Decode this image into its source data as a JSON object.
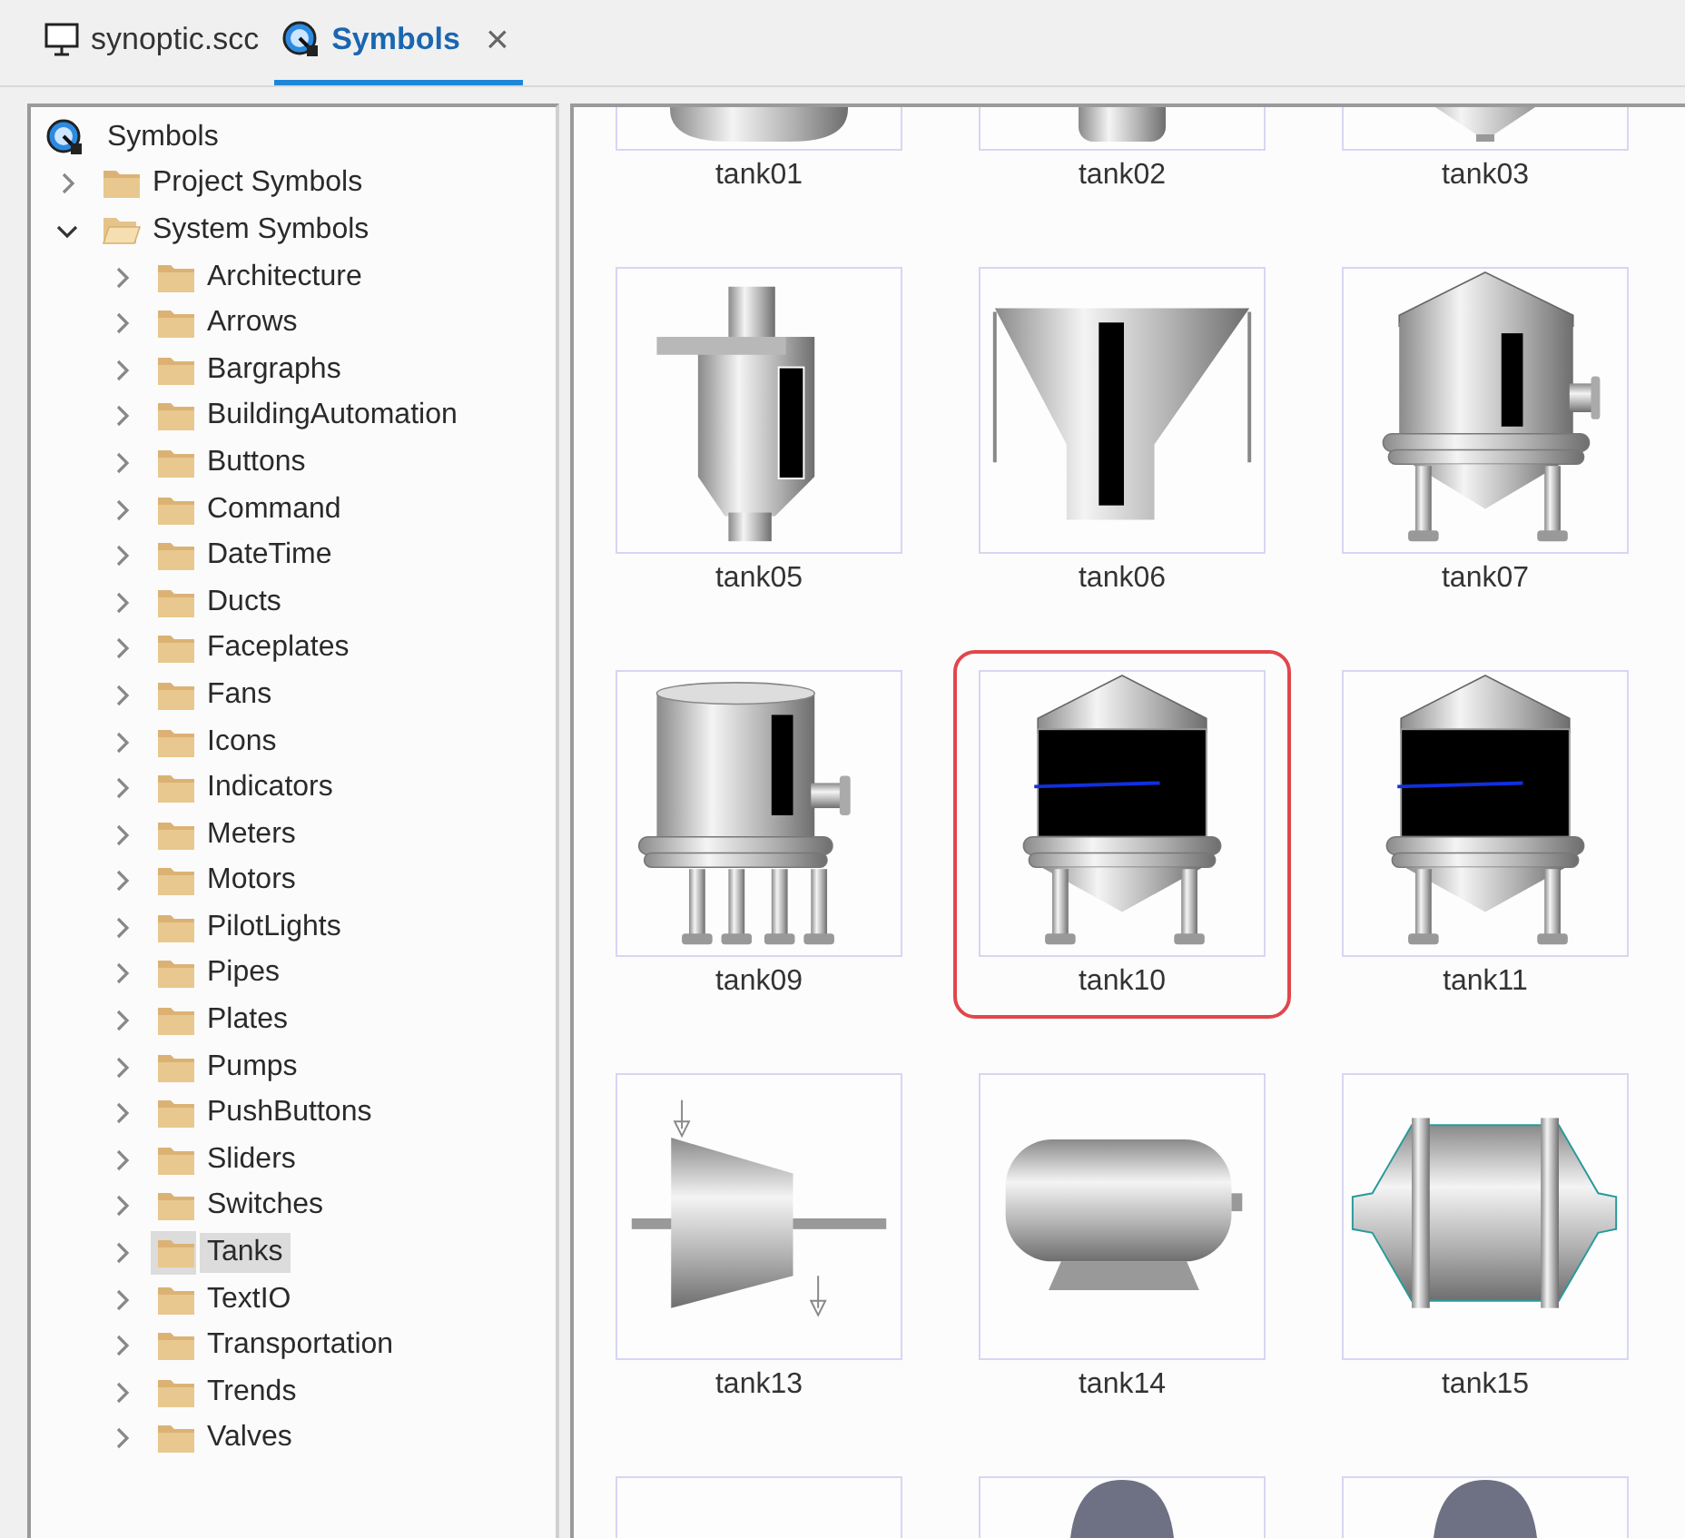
{
  "tabs": [
    {
      "kind": "monitor",
      "label": "synoptic.scc",
      "selected": false
    },
    {
      "kind": "symbols",
      "label": "Symbols",
      "selected": true,
      "close": "×"
    }
  ],
  "tree": {
    "label": "Symbols",
    "children": [
      {
        "label": "Project Symbols",
        "expanded": false,
        "selected": false
      },
      {
        "label": "System Symbols",
        "expanded": true,
        "selected": false,
        "children": [
          {
            "label": "Architecture",
            "expanded": false,
            "selected": false
          },
          {
            "label": "Arrows",
            "expanded": false,
            "selected": false
          },
          {
            "label": "Bargraphs",
            "expanded": false,
            "selected": false
          },
          {
            "label": "BuildingAutomation",
            "expanded": false,
            "selected": false
          },
          {
            "label": "Buttons",
            "expanded": false,
            "selected": false
          },
          {
            "label": "Command",
            "expanded": false,
            "selected": false
          },
          {
            "label": "DateTime",
            "expanded": false,
            "selected": false
          },
          {
            "label": "Ducts",
            "expanded": false,
            "selected": false
          },
          {
            "label": "Faceplates",
            "expanded": false,
            "selected": false
          },
          {
            "label": "Fans",
            "expanded": false,
            "selected": false
          },
          {
            "label": "Icons",
            "expanded": false,
            "selected": false
          },
          {
            "label": "Indicators",
            "expanded": false,
            "selected": false
          },
          {
            "label": "Meters",
            "expanded": false,
            "selected": false
          },
          {
            "label": "Motors",
            "expanded": false,
            "selected": false
          },
          {
            "label": "PilotLights",
            "expanded": false,
            "selected": false
          },
          {
            "label": "Pipes",
            "expanded": false,
            "selected": false
          },
          {
            "label": "Plates",
            "expanded": false,
            "selected": false
          },
          {
            "label": "Pumps",
            "expanded": false,
            "selected": false
          },
          {
            "label": "PushButtons",
            "expanded": false,
            "selected": false
          },
          {
            "label": "Sliders",
            "expanded": false,
            "selected": false
          },
          {
            "label": "Switches",
            "expanded": false,
            "selected": false
          },
          {
            "label": "Tanks",
            "expanded": false,
            "selected": true
          },
          {
            "label": "TextIO",
            "expanded": false,
            "selected": false
          },
          {
            "label": "Transportation",
            "expanded": false,
            "selected": false
          },
          {
            "label": "Trends",
            "expanded": false,
            "selected": false
          },
          {
            "label": "Valves",
            "expanded": false,
            "selected": false
          }
        ]
      }
    ]
  },
  "symbols": [
    {
      "kind": "dish",
      "label": "tank01",
      "selected": false
    },
    {
      "kind": "cylinder",
      "label": "tank02",
      "selected": false
    },
    {
      "kind": "cone",
      "label": "tank03",
      "selected": false
    },
    {
      "kind": "cyclone",
      "label": "tank05",
      "selected": false
    },
    {
      "kind": "hopper",
      "label": "tank06",
      "selected": false
    },
    {
      "kind": "silo",
      "label": "tank07",
      "selected": false
    },
    {
      "kind": "vessel",
      "label": "tank09",
      "selected": false
    },
    {
      "kind": "sight",
      "label": "tank10",
      "selected": true
    },
    {
      "kind": "sight",
      "label": "tank11",
      "selected": false
    },
    {
      "kind": "conical",
      "label": "tank13",
      "selected": false
    },
    {
      "kind": "horizontal",
      "label": "tank14",
      "selected": false
    },
    {
      "kind": "capsule",
      "label": "tank15",
      "selected": false
    },
    {
      "kind": "blank",
      "selected": false
    },
    {
      "kind": "dome",
      "selected": false
    },
    {
      "kind": "dome",
      "selected": false
    }
  ]
}
